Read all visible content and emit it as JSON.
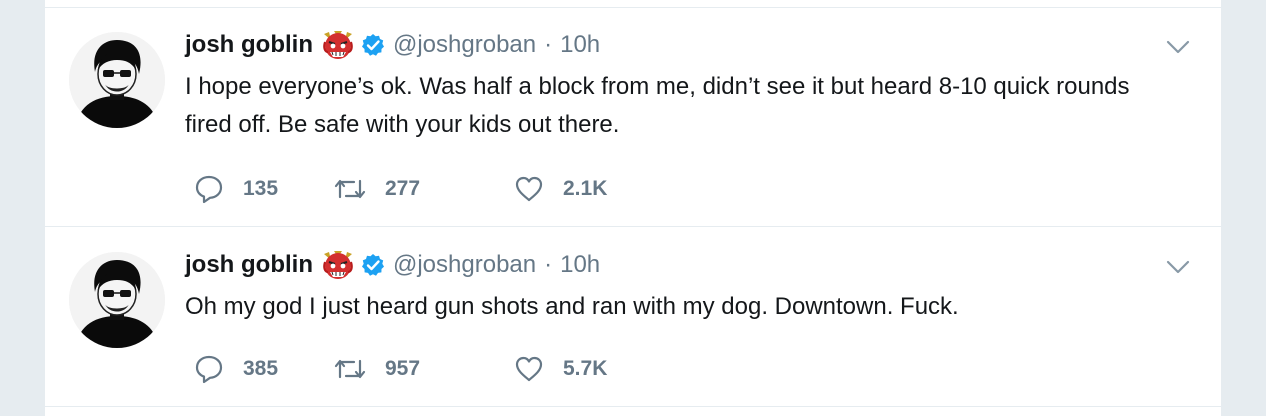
{
  "tweets": [
    {
      "name": "josh goblin",
      "name_emoji": "goblin-emoji",
      "verified": true,
      "handle": "@joshgroban",
      "separator": "·",
      "time": "10h",
      "text": "I hope everyone’s ok. Was half a block from me, didn’t see it but heard 8-10 quick rounds fired off. Be safe with your kids out there.",
      "replies": "135",
      "retweets": "277",
      "likes": "2.1K"
    },
    {
      "name": "josh goblin",
      "name_emoji": "goblin-emoji",
      "verified": true,
      "handle": "@joshgroban",
      "separator": "·",
      "time": "10h",
      "text": "Oh my god I just heard gun shots and ran with my dog. Downtown. Fuck.",
      "replies": "385",
      "retweets": "957",
      "likes": "5.7K"
    }
  ],
  "icons": {
    "reply": "reply-icon",
    "retweet": "retweet-icon",
    "like": "heart-icon",
    "menu": "chevron-down-icon",
    "verified": "verified-badge-icon"
  },
  "colors": {
    "text": "#14171a",
    "secondary": "#657786",
    "verified": "#1da1f2",
    "border": "#e6ecf0"
  }
}
